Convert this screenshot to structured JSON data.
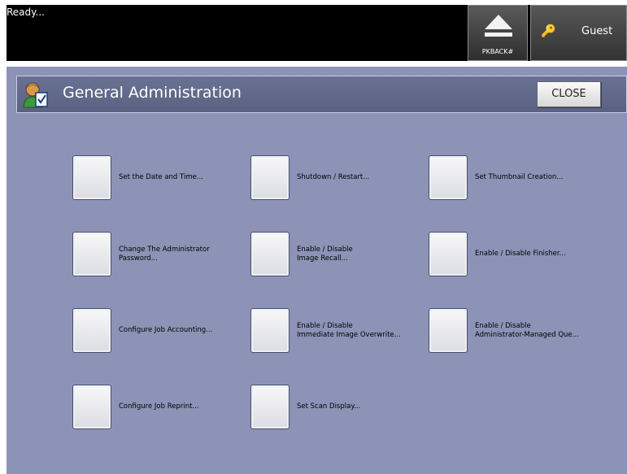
{
  "status_text": "Ready...",
  "top_buttons": {
    "pkback_label": "PKBACK#",
    "guest_label": "Guest"
  },
  "header": {
    "title": "General Administration",
    "close_label": "CLOSE"
  },
  "items": [
    {
      "label": "Set the Date and Time..."
    },
    {
      "label": "Shutdown / Restart..."
    },
    {
      "label": "Set Thumbnail Creation..."
    },
    {
      "label": "Change The Administrator\nPassword..."
    },
    {
      "label": "Enable / Disable\nImage Recall..."
    },
    {
      "label": "Enable / Disable Finisher..."
    },
    {
      "label": "Configure Job Accounting..."
    },
    {
      "label": "Enable / Disable\nImmediate Image Overwrite..."
    },
    {
      "label": "Enable / Disable\nAdministrator-Managed Que..."
    },
    {
      "label": "Configure Job Reprint..."
    },
    {
      "label": "Set Scan Display..."
    }
  ]
}
